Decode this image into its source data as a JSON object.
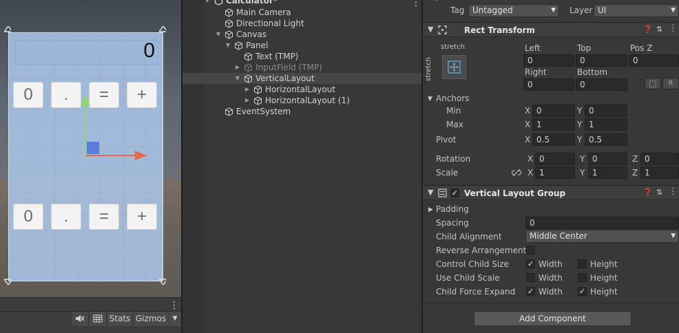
{
  "scene": {
    "display_value": "0",
    "keys_row1": [
      "0",
      ".",
      "=",
      "+"
    ],
    "keys_row2": [
      "0",
      ".",
      "=",
      "+"
    ],
    "toolbar": {
      "stats": "Stats",
      "gizmos": "Gizmos"
    }
  },
  "hierarchy": {
    "items": [
      {
        "label": "Calculator*"
      },
      {
        "label": "Main Camera"
      },
      {
        "label": "Directional Light"
      },
      {
        "label": "Canvas"
      },
      {
        "label": "Panel"
      },
      {
        "label": "Text (TMP)"
      },
      {
        "label": "InputField (TMP)"
      },
      {
        "label": "VerticalLayout"
      },
      {
        "label": "HorizontalLayout"
      },
      {
        "label": "HorizontalLayout (1)"
      },
      {
        "label": "EventSystem"
      }
    ]
  },
  "inspector": {
    "tag_label": "Tag",
    "tag_value": "Untagged",
    "layer_label": "Layer",
    "layer_value": "UI",
    "rect_transform": {
      "title": "Rect Transform",
      "stretch_h": "stretch",
      "stretch_v": "stretch",
      "left_label": "Left",
      "left": "0",
      "top_label": "Top",
      "top": "0",
      "posz_label": "Pos Z",
      "posz": "0",
      "right_label": "Right",
      "right": "0",
      "bottom_label": "Bottom",
      "bottom": "0",
      "btn_r": "R",
      "anchors_label": "Anchors",
      "min_label": "Min",
      "min_x": "0",
      "min_y": "0",
      "max_label": "Max",
      "max_x": "1",
      "max_y": "1",
      "pivot_label": "Pivot",
      "pivot_x": "0.5",
      "pivot_y": "0.5",
      "rotation_label": "Rotation",
      "rot_x": "0",
      "rot_y": "0",
      "rot_z": "0",
      "scale_label": "Scale",
      "scale_x": "1",
      "scale_y": "1",
      "scale_z": "1",
      "x": "X",
      "y": "Y",
      "z": "Z"
    },
    "vertical_layout": {
      "title": "Vertical Layout Group",
      "padding_label": "Padding",
      "spacing_label": "Spacing",
      "spacing": "0",
      "child_alignment_label": "Child Alignment",
      "child_alignment": "Middle Center",
      "reverse_label": "Reverse Arrangement",
      "control_size_label": "Control Child Size",
      "use_scale_label": "Use Child Scale",
      "force_expand_label": "Child Force Expand",
      "width_label": "Width",
      "height_label": "Height"
    },
    "add_component": "Add Component"
  },
  "colors": {
    "canvas_fill": "#acc8ec",
    "gizmo_y": "#8fd96a",
    "gizmo_x": "#e26b4e",
    "selection": "#474747"
  }
}
